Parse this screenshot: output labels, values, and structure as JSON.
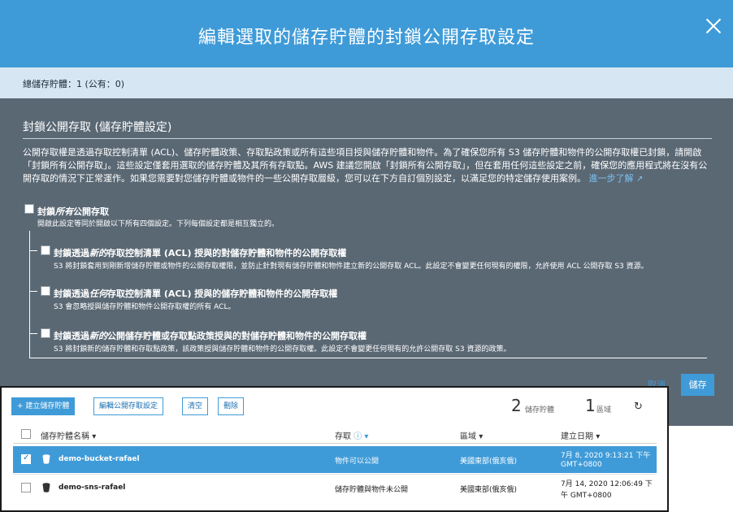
{
  "modal": {
    "title": "編輯選取的儲存貯體的封鎖公開存取設定",
    "summary": "總儲存貯體：1 (公有：0)",
    "section_title": "封鎖公開存取 (儲存貯體設定)",
    "description": "公開存取權是透過存取控制清單 (ACL)、儲存貯體政策、存取點政策或所有這些項目授與儲存貯體和物件。為了確保您所有 S3 儲存貯體和物件的公開存取權已封鎖，請開啟「封鎖所有公開存取」。這些設定僅套用選取的儲存貯體及其所有存取點。AWS 建議您開啟「封鎖所有公開存取」，但在套用任何這些設定之前，確保您的應用程式將在沒有公開存取的情況下正常運作。如果您需要對您儲存貯體或物件的一些公開存取層級，您可以在下方自訂個別設定，以滿足您的特定儲存使用案例。",
    "learn_more": "進一步了解",
    "block_all": {
      "label_prefix": "封鎖",
      "label_em": "所有",
      "label_suffix": "公開存取",
      "sub": "開啟此設定等同於開啟以下所有四個設定。下列每個設定都是相互獨立的。"
    },
    "options": [
      {
        "prefix": "封鎖透過",
        "em": "新的",
        "suffix": "存取控制清單 (ACL) 授與的對儲存貯體和物件的公開存取權",
        "desc": "S3 將封鎖套用到剛新增儲存貯體或物件的公開存取權限，並防止針對現有儲存貯體和物件建立新的公開存取 ACL。此設定不會變更任何現有的權限，允許使用 ACL 公開存取 S3 資源。"
      },
      {
        "prefix": "封鎖透過",
        "em": "任何",
        "suffix": "存取控制清單 (ACL) 授與的儲存貯體和物件的公開存取權",
        "desc": "S3 會忽略授與儲存貯體和物件公開存取權的所有 ACL。"
      },
      {
        "prefix": "封鎖透過",
        "em": "新的",
        "suffix": "公開儲存貯體或存取點政策授與的對儲存貯體和物件的公開存取權",
        "desc": "S3 將封鎖新的儲存貯體和存取點政策，該政策授與儲存貯體和物件的公開存取權。此設定不會變更任何現有的允許公開存取 S3 資源的政策。"
      }
    ],
    "cancel_label": "取消",
    "save_label": "儲存"
  },
  "toolbar": {
    "create_label": "建立儲存貯體",
    "edit_label": "編輯公開存取設定",
    "empty_label": "清空",
    "delete_label": "刪除",
    "bucket_count": "2",
    "bucket_count_label": "儲存貯體",
    "region_count": "1",
    "region_count_label": "區域"
  },
  "table": {
    "headers": {
      "name": "儲存貯體名稱",
      "access": "存取",
      "region": "區域",
      "created": "建立日期"
    },
    "rows": [
      {
        "name": "demo-bucket-rafael",
        "access": "物件可以公開",
        "region": "美國東部(俄亥俄)",
        "created_line1": "7月 8, 2020 9:13:21 下午",
        "created_line2": "GMT+0800",
        "selected": true
      },
      {
        "name": "demo-sns-rafael",
        "access": "儲存貯體與物件未公開",
        "region": "美國東部(俄亥俄)",
        "created_line1": "7月 14, 2020 12:06:49 下",
        "created_line2": "午 GMT+0800",
        "selected": false
      }
    ]
  },
  "colors": {
    "accent": "#3f9bd8",
    "modal_body": "#5a6874",
    "summary_bar": "#d6e6f2"
  }
}
